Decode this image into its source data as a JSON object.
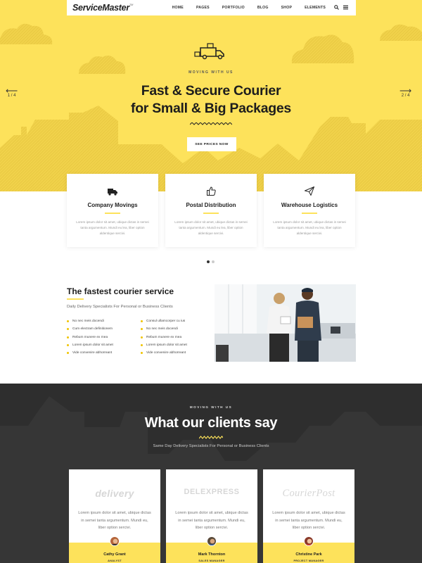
{
  "nav": {
    "logo": "ServiceMaster",
    "logo_tm": "TM",
    "items": [
      "HOME",
      "PAGES",
      "PORTFOLIO",
      "BLOG",
      "SHOP",
      "ELEMENTS"
    ],
    "icons": [
      "search-icon",
      "menu-icon"
    ]
  },
  "hero": {
    "eyebrow": "MOVING WITH US",
    "title_line1": "Fast & Secure Courier",
    "title_line2": "for Small & Big Packages",
    "cta": "SEE PRICES NOW",
    "prev_counter": "1 / 4",
    "next_counter": "2 / 4",
    "colors": {
      "accent": "#fde25b",
      "accent_dark": "#e8c93e"
    }
  },
  "services": [
    {
      "icon": "truck-icon",
      "title": "Company Movings",
      "text": "Lorem ipsum dolor sit amet, ubique dictas in semei tanta argumentum. Mundi eu lea, liber option aldentique sercivi."
    },
    {
      "icon": "thumbs-up-icon",
      "title": "Postal Distribution",
      "text": "Lorem ipsum dolor sit amet, ubique dictas in semei tanta argumentum. Mundi eu lea, liber option aldentique sercivi."
    },
    {
      "icon": "paper-plane-icon",
      "title": "Warehouse Logistics",
      "text": "Lorem ipsum dolor sit amet, ubique dictas in semei tanta argumentum. Mundi eu lea, liber option aldentique sercivi."
    }
  ],
  "feature": {
    "title": "The fastest courier service",
    "subtitle": "Daily Delivery Specialists For Personal or Business Clients",
    "list": [
      "No nec meis docendi",
      "Consul ullamcorper cu ius",
      "Cum electram definitionem",
      "No nec meis docendi",
      "Rebum munere ex mea",
      "Rebum munere ex mea",
      "Lorem ipsum dolor sit amet",
      "Lorem ipsum dolor sit amet",
      "Vide convenire abhorreant",
      "Vide convenire abhorreant"
    ]
  },
  "testimonials": {
    "eyebrow": "MOVING WITH US",
    "title": "What our clients say",
    "subtitle": "Same Day Delivery Specialists For Personal or Business Clients",
    "items": [
      {
        "brand": "delivery",
        "text": "Lorem ipsum dolor sit amet, ubique dictas in semei tanta argumentum. Mundi eu, liber option sercivi.",
        "name": "Cathy Grant",
        "role": "ANALYST"
      },
      {
        "brand": "DELEXPRESS",
        "text": "Lorem ipsum dolor sit amet, ubique dictas in semei tanta argumentum. Mundi eu, liber option sercivi.",
        "name": "Mark Thornton",
        "role": "SALES MANAGER"
      },
      {
        "brand": "CourierPost",
        "text": "Lorem ipsum dolor sit amet, ubique dictas in semei tanta argumentum. Mundi eu, liber option sercivi.",
        "name": "Christine Park",
        "role": "PROJECT MANAGER"
      }
    ]
  }
}
